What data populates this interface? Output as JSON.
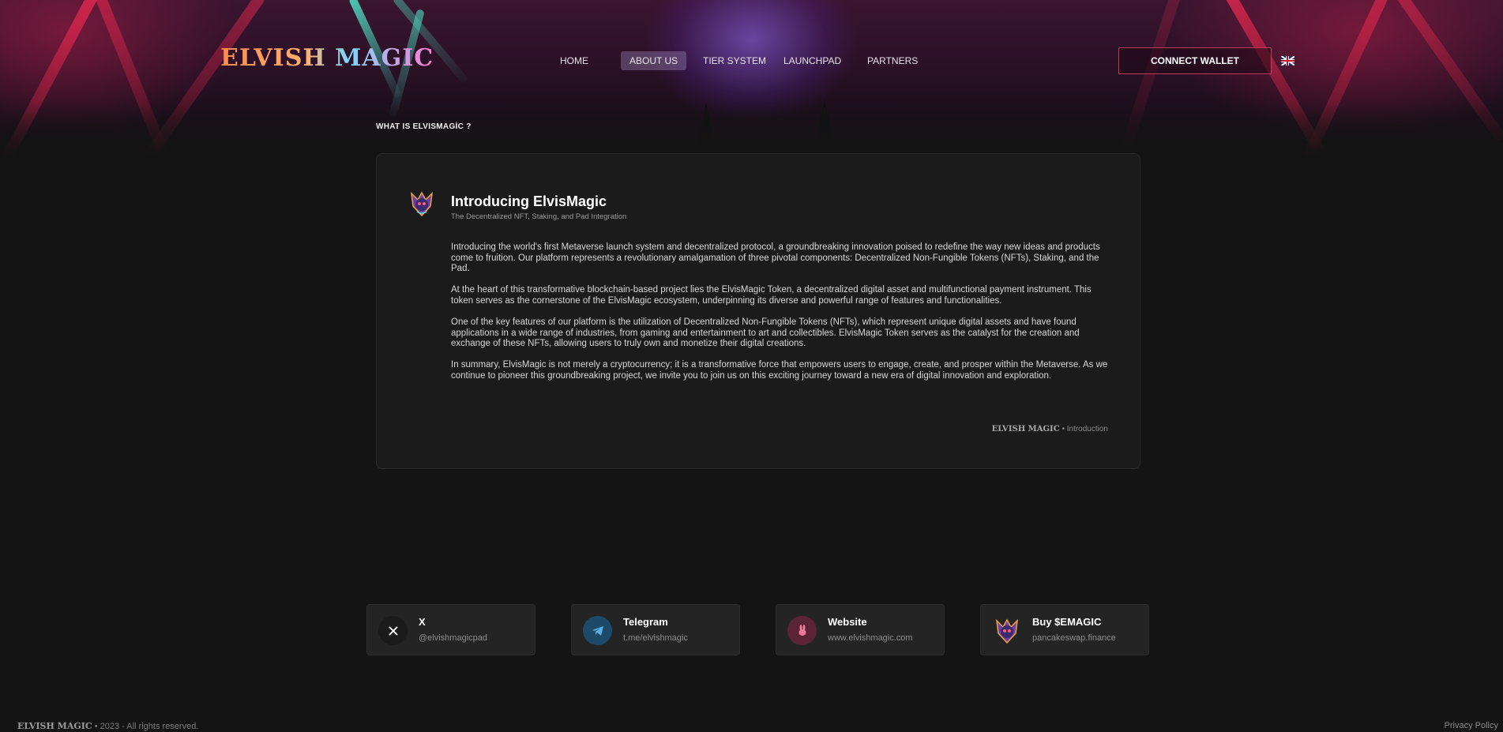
{
  "header": {
    "logo_text": "ELVISH MAGIC",
    "nav": [
      "HOME",
      "ABOUT US",
      "TIER SYSTEM",
      "LAUNCHPAD",
      "PARTNERS"
    ],
    "active_nav": "ABOUT US",
    "connect_wallet": "CONNECT WALLET",
    "language_icon": "uk-flag-icon"
  },
  "section_label": "WHAT IS ELVISMAGİC ?",
  "intro": {
    "title": "Introducing ElvisMagic",
    "subtitle": "The Decentralized NFT, Staking, and Pad Integration",
    "paragraphs": [
      "Introducing the world's first Metaverse launch system and decentralized protocol, a groundbreaking innovation poised to redefine the way new ideas and products come to fruition. Our platform represents a revolutionary amalgamation of three pivotal components: Decentralized Non-Fungible Tokens (NFTs), Staking, and the Pad.",
      "At the heart of this transformative blockchain-based project lies the ElvisMagic Token, a decentralized digital asset and multifunctional payment instrument. This token serves as the cornerstone of the ElvisMagic ecosystem, underpinning its diverse and powerful range of features and functionalities.",
      "One of the key features of our platform is the utilization of Decentralized Non-Fungible Tokens (NFTs), which represent unique digital assets and have found applications in a wide range of industries, from gaming and entertainment to art and collectibles. ElvisMagic Token serves as the catalyst for the creation and exchange of these NFTs, allowing users to truly own and monetize their digital creations.",
      "In summary, ElvisMagic is not merely a cryptocurrency; it is a transformative force that empowers users to engage, create, and prosper within the Metaverse. As we continue to pioneer this groundbreaking project, we invite you to join us on this exciting journey toward a new era of digital innovation and exploration."
    ],
    "footer_brand": "ELVISH MAGIC",
    "footer_separator": "•",
    "footer_label": "Introduction"
  },
  "socials": [
    {
      "title": "X",
      "subtitle": "@elvishmagicpad",
      "icon": "x-icon",
      "color": "#1b1b1b"
    },
    {
      "title": "Telegram",
      "subtitle": "t.me/elvishmagic",
      "icon": "telegram-icon",
      "color": "#1d4a68"
    },
    {
      "title": "Website",
      "subtitle": "www.elvishmagic.com",
      "icon": "globe-rabbit-icon",
      "color": "#5a2436"
    },
    {
      "title": "Buy $EMAGIC",
      "subtitle": "pancakeswap.finance",
      "icon": "mascot-icon",
      "color": "#2c2c2c"
    }
  ],
  "footer": {
    "brand": "ELVISH MAGIC",
    "copyright": "• 2023 - All rights reserved.",
    "privacy": "Privacy Policy"
  }
}
